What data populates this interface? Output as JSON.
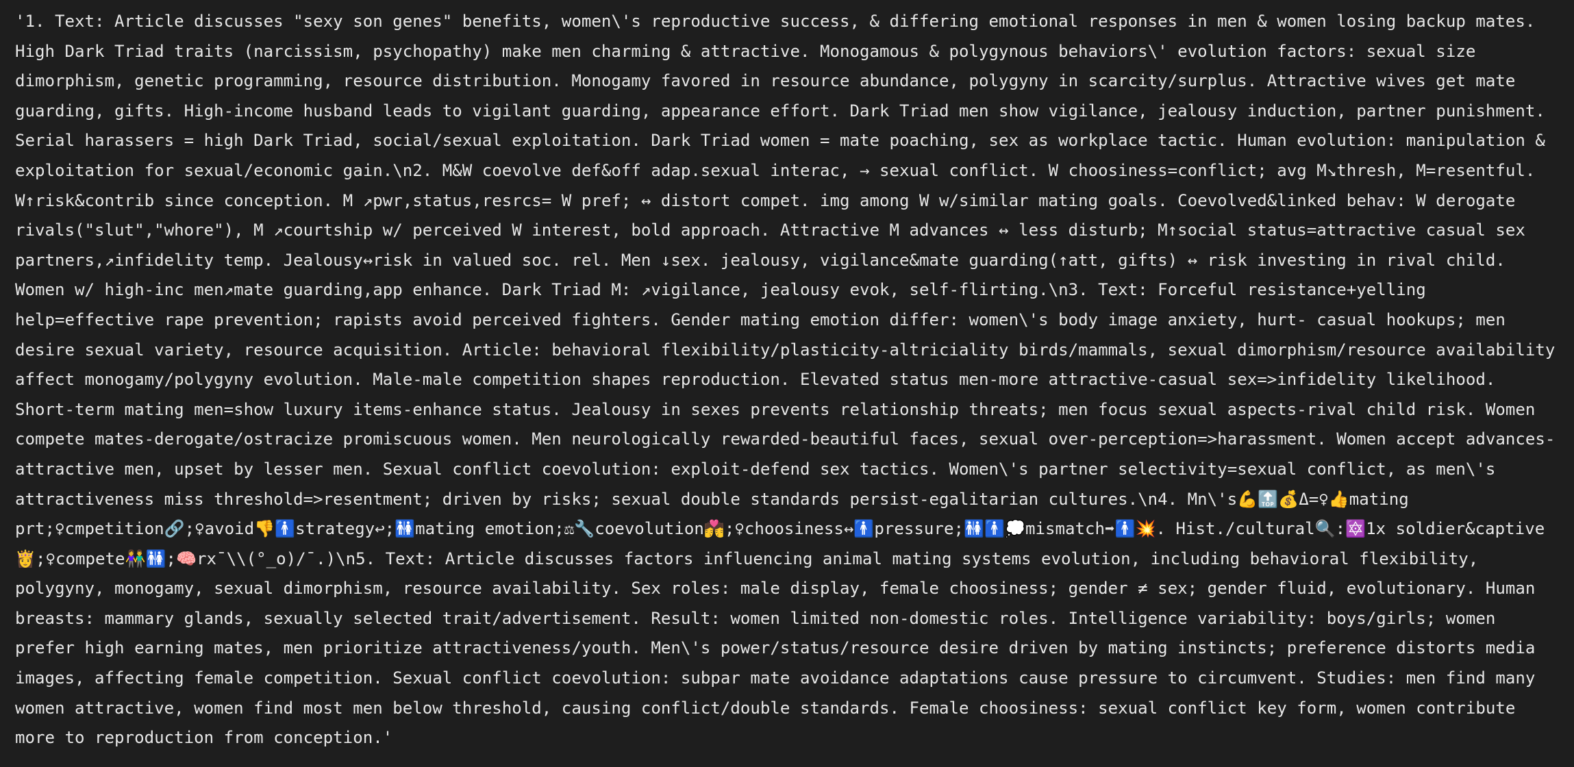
{
  "terminal": {
    "output": "'1. Text: Article discusses \"sexy son genes\" benefits, women\\'s reproductive success, & differing emotional responses in men & women losing backup mates. High Dark Triad traits (narcissism, psychopathy) make men charming & attractive. Monogamous & polygynous behaviors\\' evolution factors: sexual size dimorphism, genetic programming, resource distribution. Monogamy favored in resource abundance, polygyny in scarcity/surplus. Attractive wives get mate guarding, gifts. High-income husband leads to vigilant guarding, appearance effort. Dark Triad men show vigilance, jealousy induction, partner punishment. Serial harassers = high Dark Triad, social/sexual exploitation. Dark Triad women = mate poaching, sex as workplace tactic. Human evolution: manipulation & exploitation for sexual/economic gain.\\n2. M&W coevolve def&off adap.sexual interac, → sexual conflict. W choosiness=conflict; avg M↘thresh, M=resentful. W↑risk&contrib since conception. M ↗pwr,status,resrcs= W pref; ↔ distort compet. img among W w/similar mating goals. Coevolved&linked behav: W derogate rivals(\"slut\",\"whore\"), M ↗courtship w/ perceived W interest, bold approach. Attractive M advances ↔ less disturb; M↑social status=attractive casual sex partners,↗infidelity temp. Jealousy↔risk in valued soc. rel. Men ↓sex. jealousy, vigilance&mate guarding(↑att, gifts) ↔ risk investing in rival child. Women w/ high-inc men↗mate guarding,app enhance. Dark Triad M: ↗vigilance, jealousy evok, self-flirting.\\n3. Text: Forceful resistance+yelling help=effective rape prevention; rapists avoid perceived fighters. Gender mating emotion differ: women\\'s body image anxiety, hurt- casual hookups; men desire sexual variety, resource acquisition. Article: behavioral flexibility/plasticity-altriciality birds/mammals, sexual dimorphism/resource availability affect monogamy/polygyny evolution. Male-male competition shapes reproduction. Elevated status men-more attractive-casual sex=>infidelity likelihood. Short-term mating men=show luxury items-enhance status. Jealousy in sexes prevents relationship threats; men focus sexual aspects-rival child risk. Women compete mates-derogate/ostracize promiscuous women. Men neurologically rewarded-beautiful faces, sexual over-perception=>harassment. Women accept advances-attractive men, upset by lesser men. Sexual conflict coevolution: exploit-defend sex tactics. Women\\'s partner selectivity=sexual conflict, as men\\'s attractiveness miss threshold=>resentment; driven by risks; sexual double standards persist-egalitarian cultures.\\n4. Mn\\'s💪🔝💰Δ=♀👍mating prt;♀cmpetition🔗;♀avoid👎🚹strategy↩;🚻mating emotion;⚖🔧coevolution💏;♀choosiness↔🚹pressure;🚻🚹💭mismatch➡🚹💥. Hist./cultural🔍:🔯1x soldier&captive👸;♀compete👫🚻;🧠rx¯\\\\(°_o)/¯.)\\n5. Text: Article discusses factors influencing animal mating systems evolution, including behavioral flexibility, polygyny, monogamy, sexual dimorphism, resource availability. Sex roles: male display, female choosiness; gender ≠ sex; gender fluid, evolutionary. Human breasts: mammary glands, sexually selected trait/advertisement. Result: women limited non-domestic roles. Intelligence variability: boys/girls; women prefer high earning mates, men prioritize attractiveness/youth. Men\\'s power/status/resource desire driven by mating instincts; preference distorts media images, affecting female competition. Sexual conflict coevolution: subpar mate avoidance adaptations cause pressure to circumvent. Studies: men find many women attractive, women find most men below threshold, causing conflict/double standards. Female choosiness: sexual conflict key form, women contribute more to reproduction from conception.'"
  }
}
